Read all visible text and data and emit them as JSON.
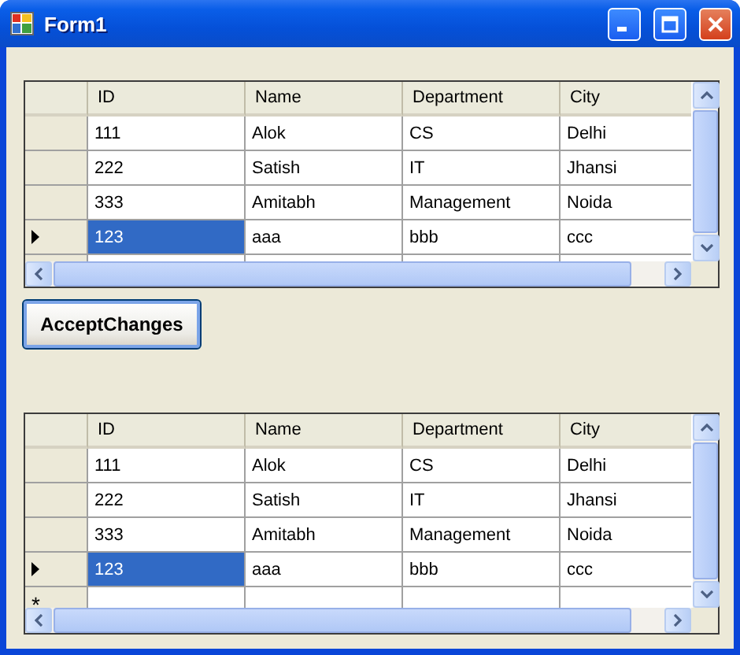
{
  "window": {
    "title": "Form1"
  },
  "grids": [
    {
      "columns": [
        "ID",
        "Name",
        "Department",
        "City"
      ],
      "rows": [
        {
          "current": false,
          "cells": [
            {
              "text": "111",
              "selected": false
            },
            {
              "text": "Alok",
              "selected": false
            },
            {
              "text": "CS",
              "selected": false
            },
            {
              "text": "Delhi",
              "selected": false
            }
          ]
        },
        {
          "current": false,
          "cells": [
            {
              "text": "222",
              "selected": false
            },
            {
              "text": "Satish",
              "selected": false
            },
            {
              "text": "IT",
              "selected": false
            },
            {
              "text": "Jhansi",
              "selected": false
            }
          ]
        },
        {
          "current": false,
          "cells": [
            {
              "text": "333",
              "selected": false
            },
            {
              "text": "Amitabh",
              "selected": false
            },
            {
              "text": "Management",
              "selected": false
            },
            {
              "text": "Noida",
              "selected": false
            }
          ]
        },
        {
          "current": true,
          "cells": [
            {
              "text": "123",
              "selected": true
            },
            {
              "text": "aaa",
              "selected": false
            },
            {
              "text": "bbb",
              "selected": false
            },
            {
              "text": "ccc",
              "selected": false
            }
          ]
        }
      ]
    },
    {
      "columns": [
        "ID",
        "Name",
        "Department",
        "City"
      ],
      "rows": [
        {
          "current": false,
          "cells": [
            {
              "text": "111",
              "selected": false
            },
            {
              "text": "Alok",
              "selected": false
            },
            {
              "text": "CS",
              "selected": false
            },
            {
              "text": "Delhi",
              "selected": false
            }
          ]
        },
        {
          "current": false,
          "cells": [
            {
              "text": "222",
              "selected": false
            },
            {
              "text": "Satish",
              "selected": false
            },
            {
              "text": "IT",
              "selected": false
            },
            {
              "text": "Jhansi",
              "selected": false
            }
          ]
        },
        {
          "current": false,
          "cells": [
            {
              "text": "333",
              "selected": false
            },
            {
              "text": "Amitabh",
              "selected": false
            },
            {
              "text": "Management",
              "selected": false
            },
            {
              "text": "Noida",
              "selected": false
            }
          ]
        },
        {
          "current": true,
          "cells": [
            {
              "text": "123",
              "selected": true
            },
            {
              "text": "aaa",
              "selected": false
            },
            {
              "text": "bbb",
              "selected": false
            },
            {
              "text": "ccc",
              "selected": false
            }
          ]
        }
      ],
      "new_row_marker": "*"
    }
  ],
  "button": {
    "label": "AcceptChanges"
  }
}
